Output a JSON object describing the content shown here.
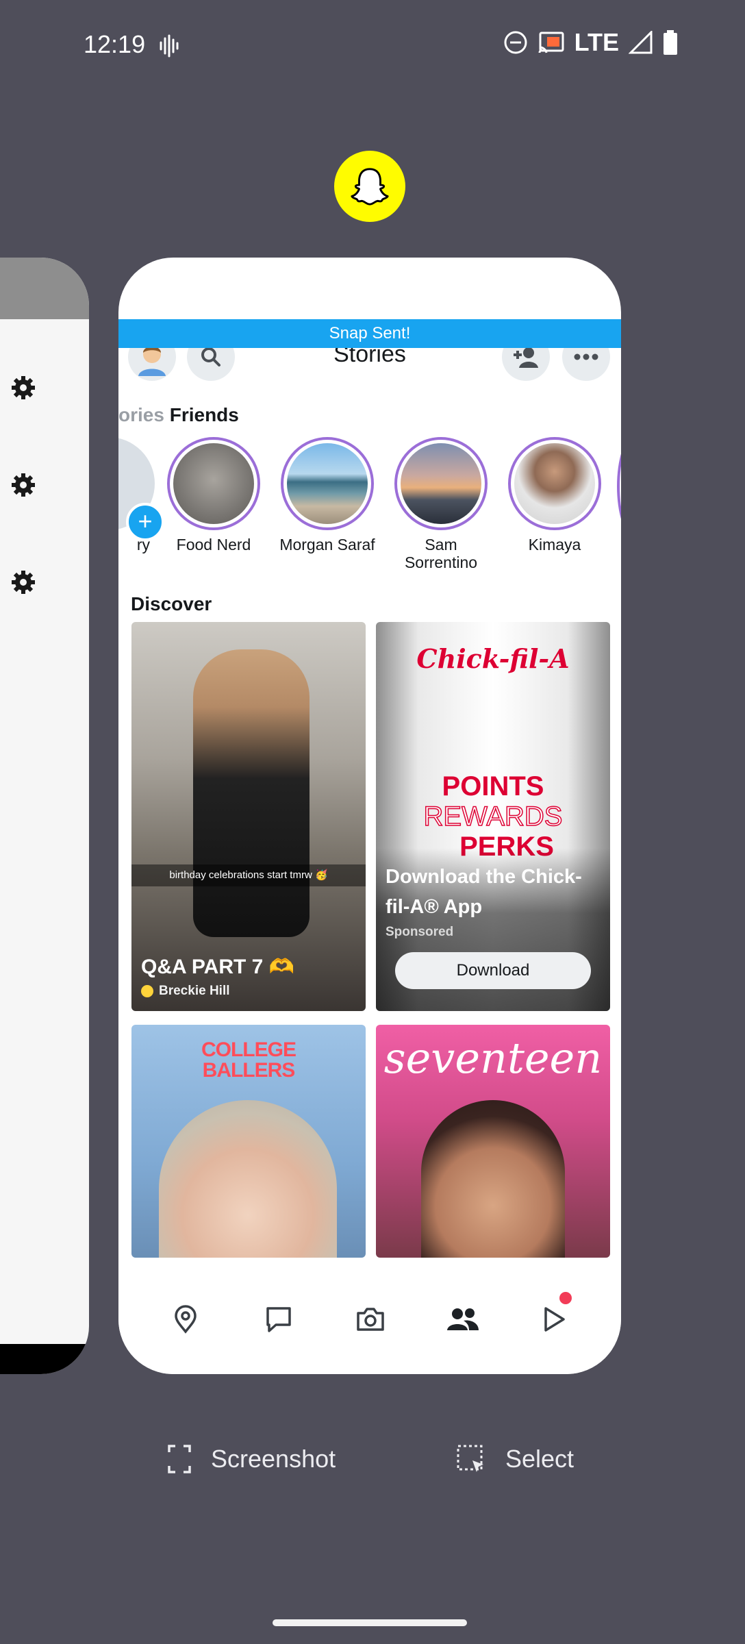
{
  "status_bar": {
    "time": "12:19",
    "network": "LTE",
    "icons": [
      "voice-activity-icon",
      "do-not-disturb-icon",
      "cast-icon",
      "signal-icon",
      "battery-icon"
    ]
  },
  "app_icon": {
    "name": "snapchat-ghost-icon",
    "color": "#fffc00"
  },
  "snapchat": {
    "banner": "Snap Sent!",
    "header": {
      "title": "Stories"
    },
    "friends_section": {
      "partial_label": "ories",
      "label": "Friends"
    },
    "stories": [
      {
        "name": "ry"
      },
      {
        "name": "Food Nerd"
      },
      {
        "name": "Morgan Saraf"
      },
      {
        "name": "Sam Sorrentino"
      },
      {
        "name": "Kimaya"
      }
    ],
    "discover": {
      "label": "Discover",
      "tiles": [
        {
          "caption": "birthday celebrations start tmrw 🥳",
          "title": "Q&A PART 7 🫶",
          "creator": "Breckie Hill"
        },
        {
          "brand": "Chick-fil-A",
          "promo_line1": "POINTS",
          "promo_line2": "REWARDS",
          "promo_line3": "PERKS",
          "title": "Download the Chick-fil-A® App",
          "tag": "Sponsored",
          "button": "Download"
        },
        {
          "title": "COLLEGE BALLERS"
        },
        {
          "title": "seventeen"
        }
      ]
    },
    "nav": [
      "map-pin-icon",
      "chat-icon",
      "camera-icon",
      "friends-icon",
      "spotlight-play-icon"
    ]
  },
  "actions": {
    "screenshot": "Screenshot",
    "select": "Select"
  },
  "colors": {
    "background": "#4f4e5a",
    "banner": "#18a4f0",
    "story_ring": "#9b6ed8",
    "notification": "#f23c57"
  }
}
